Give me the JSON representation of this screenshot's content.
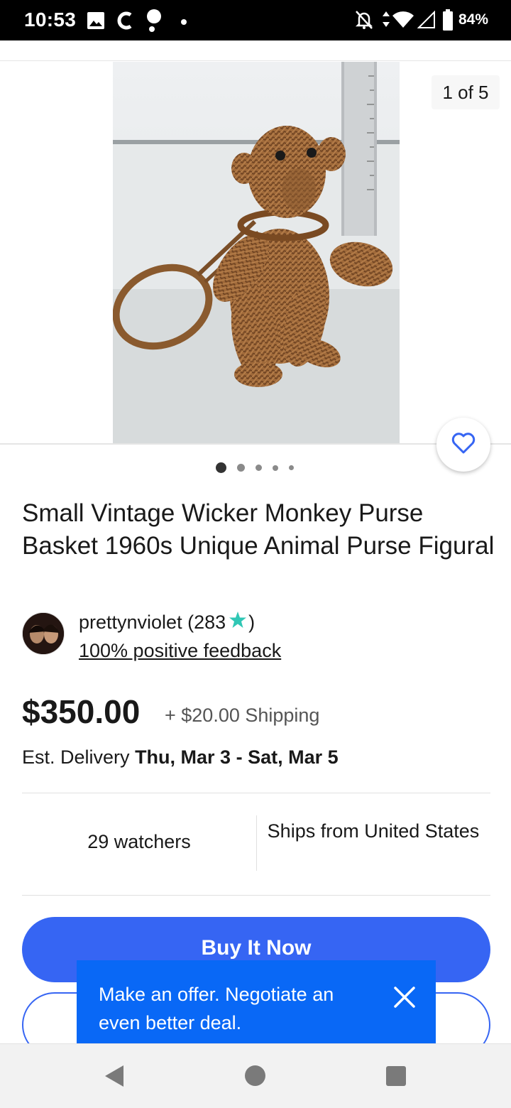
{
  "status_bar": {
    "time": "10:53",
    "battery": "84%",
    "icons": [
      "image-icon",
      "c-icon",
      "assistant-icon",
      "dot-icon",
      "mute-icon",
      "data-icon",
      "wifi-icon",
      "signal-icon",
      "battery-icon"
    ]
  },
  "gallery": {
    "counter": "1 of 5",
    "image_subject": "wicker monkey purse",
    "dots_total": 5,
    "dots_active": 1
  },
  "listing": {
    "title": "Small Vintage Wicker Monkey Purse Basket 1960s Unique Animal Purse Figural"
  },
  "seller": {
    "name_prefix": "prettynviolet (283",
    "name_suffix": ")",
    "feedback": "100% positive feedback",
    "star_color": "#30c7b5"
  },
  "price": {
    "amount": "$350.00",
    "shipping": "+ $20.00 Shipping"
  },
  "delivery": {
    "label": "Est. Delivery",
    "dates": "Thu, Mar 3 - Sat, Mar 5"
  },
  "stats": {
    "watchers": "29 watchers",
    "ships_from": "Ships from United States"
  },
  "actions": {
    "buy_now": "Buy It Now"
  },
  "tooltip": {
    "text": "Make an offer. Negotiate an even better deal."
  },
  "colors": {
    "primary": "#3665f3",
    "tooltip": "#0968f6"
  }
}
